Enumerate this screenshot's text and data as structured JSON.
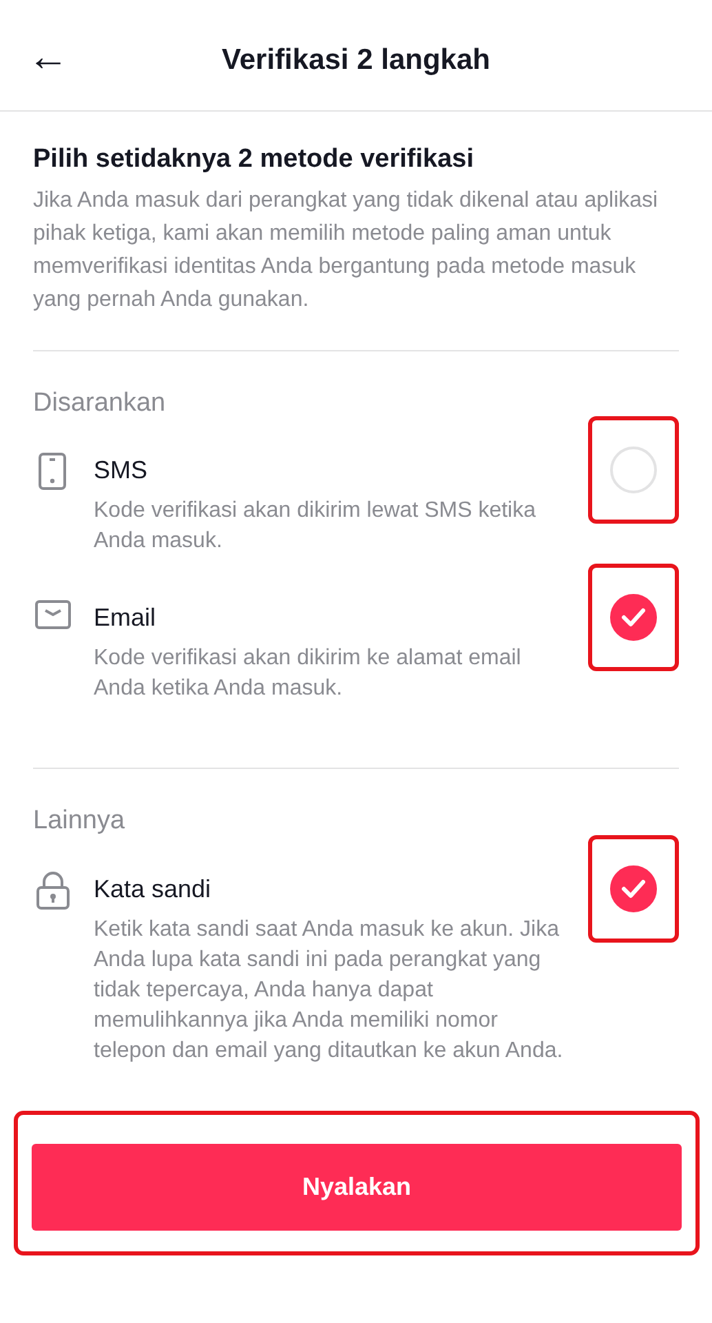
{
  "header": {
    "back_icon": "←",
    "title": "Verifikasi 2 langkah"
  },
  "intro": {
    "title": "Pilih setidaknya 2 metode verifikasi",
    "description": "Jika Anda masuk dari perangkat yang tidak dikenal atau aplikasi pihak ketiga, kami akan memilih metode paling aman untuk memverifikasi identitas Anda bergantung pada metode masuk yang pernah Anda gunakan."
  },
  "sections": [
    {
      "heading": "Disarankan",
      "methods": [
        {
          "kind": "phone",
          "name": "SMS",
          "description": "Kode verifikasi akan dikirim lewat SMS ketika Anda masuk.",
          "checked": false,
          "highlighted": true
        },
        {
          "kind": "email",
          "name": "Email",
          "description": "Kode verifikasi akan dikirim ke alamat email Anda ketika Anda masuk.",
          "checked": true,
          "highlighted": true
        }
      ]
    },
    {
      "heading": "Lainnya",
      "methods": [
        {
          "kind": "password",
          "name": "Kata sandi",
          "description": "Ketik kata sandi saat Anda masuk ke akun. Jika Anda lupa kata sandi ini pada perangkat yang tidak tepercaya, Anda hanya dapat memulihkannya jika Anda memiliki nomor telepon dan email yang ditautkan ke akun Anda.",
          "checked": true,
          "highlighted": true
        }
      ]
    }
  ],
  "button": {
    "label": "Nyalakan",
    "highlighted": true
  }
}
